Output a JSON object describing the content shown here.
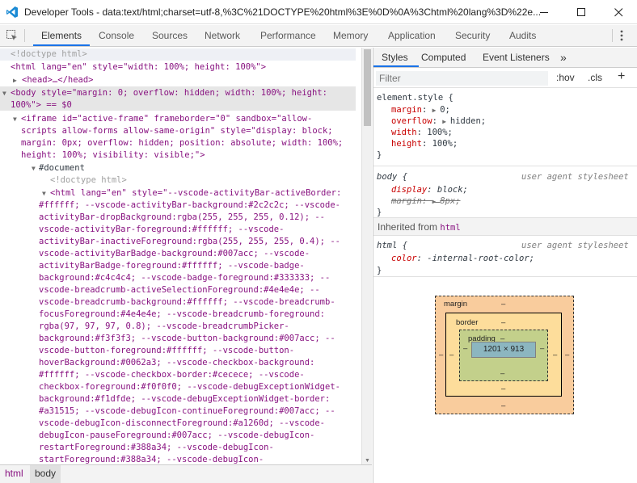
{
  "window": {
    "title": "Developer Tools - data:text/html;charset=utf-8,%3C%21DOCTYPE%20html%3E%0D%0A%3Chtml%20lang%3D%22e...",
    "minimize": "—",
    "maximize": "☐",
    "close": "✕"
  },
  "tabs": [
    "Elements",
    "Console",
    "Sources",
    "Network",
    "Performance",
    "Memory",
    "Application",
    "Security",
    "Audits"
  ],
  "active_tab": "Elements",
  "elements": {
    "doctype": "<!doctype html>",
    "html_open": "<html lang=\"en\" style=\"width: 100%; height: 100%\">",
    "head": "<head>…</head>",
    "body_line1": "<body style=\"margin: 0; overflow: hidden; width: 100%; height:",
    "body_line2": "100%\"> == $0",
    "iframe_lines": [
      "<iframe id=\"active-frame\" frameborder=\"0\" sandbox=\"allow-",
      "scripts allow-forms allow-same-origin\" style=\"display: block;",
      "margin: 0px; overflow: hidden; position: absolute; width: 100%;",
      "height: 100%; visibility: visible;\">"
    ],
    "document": "#document",
    "inner_doctype": "<!doctype html>",
    "inner_html_lines": [
      "<html lang=\"en\" style=\"--vscode-activityBar-activeBorder:",
      "#ffffff; --vscode-activityBar-background:#2c2c2c; --vscode-",
      "activityBar-dropBackground:rgba(255, 255, 255, 0.12); --",
      "vscode-activityBar-foreground:#ffffff; --vscode-",
      "activityBar-inactiveForeground:rgba(255, 255, 255, 0.4); --",
      "vscode-activityBarBadge-background:#007acc; --vscode-",
      "activityBarBadge-foreground:#ffffff; --vscode-badge-",
      "background:#c4c4c4; --vscode-badge-foreground:#333333; --",
      "vscode-breadcrumb-activeSelectionForeground:#4e4e4e; --",
      "vscode-breadcrumb-background:#ffffff; --vscode-breadcrumb-",
      "focusForeground:#4e4e4e; --vscode-breadcrumb-foreground:",
      "rgba(97, 97, 97, 0.8); --vscode-breadcrumbPicker-",
      "background:#f3f3f3; --vscode-button-background:#007acc; --",
      "vscode-button-foreground:#ffffff; --vscode-button-",
      "hoverBackground:#0062a3; --vscode-checkbox-background:",
      "#ffffff; --vscode-checkbox-border:#cecece; --vscode-",
      "checkbox-foreground:#f0f0f0; --vscode-debugExceptionWidget-",
      "background:#f1dfde; --vscode-debugExceptionWidget-border:",
      "#a31515; --vscode-debugIcon-continueForeground:#007acc; --",
      "vscode-debugIcon-disconnectForeground:#a1260d; --vscode-",
      "debugIcon-pauseForeground:#007acc; --vscode-debugIcon-",
      "restartForeground:#388a34; --vscode-debugIcon-",
      "startForeground:#388a34; --vscode-debugIcon-"
    ]
  },
  "breadcrumbs": [
    "html",
    "body"
  ],
  "styles_tabs": [
    "Styles",
    "Computed",
    "Event Listeners"
  ],
  "styles_more": "»",
  "filter": {
    "placeholder": "Filter",
    "hov": ":hov",
    "cls": ".cls",
    "add": "+"
  },
  "rules": {
    "element_style": {
      "selector": "element.style {",
      "props": [
        {
          "name": "margin",
          "value": "0;",
          "expand": true
        },
        {
          "name": "overflow",
          "value": "hidden;",
          "expand": true
        },
        {
          "name": "width",
          "value": "100%;"
        },
        {
          "name": "height",
          "value": "100%;"
        }
      ],
      "close": "}"
    },
    "body_ua": {
      "selector": "body {",
      "source": "user agent stylesheet",
      "props": [
        {
          "name": "display",
          "value": "block;"
        },
        {
          "name": "margin",
          "value": "8px;",
          "overridden": true
        }
      ],
      "close": "}"
    },
    "inherited_label": "Inherited from",
    "inherited_from": "html",
    "html_ua": {
      "selector": "html {",
      "source": "user agent stylesheet",
      "props": [
        {
          "name": "color",
          "value": "-internal-root-color;"
        }
      ],
      "close": "}"
    }
  },
  "box_model": {
    "margin_label": "margin",
    "border_label": "border",
    "padding_label": "padding",
    "dash": "–",
    "content_size": "1201 × 913"
  },
  "colors": {
    "accent": "#1a73e8",
    "tag": "#881280",
    "attr_name": "#994500",
    "attr_value": "#1a1aa6",
    "prop": "#c80000"
  }
}
